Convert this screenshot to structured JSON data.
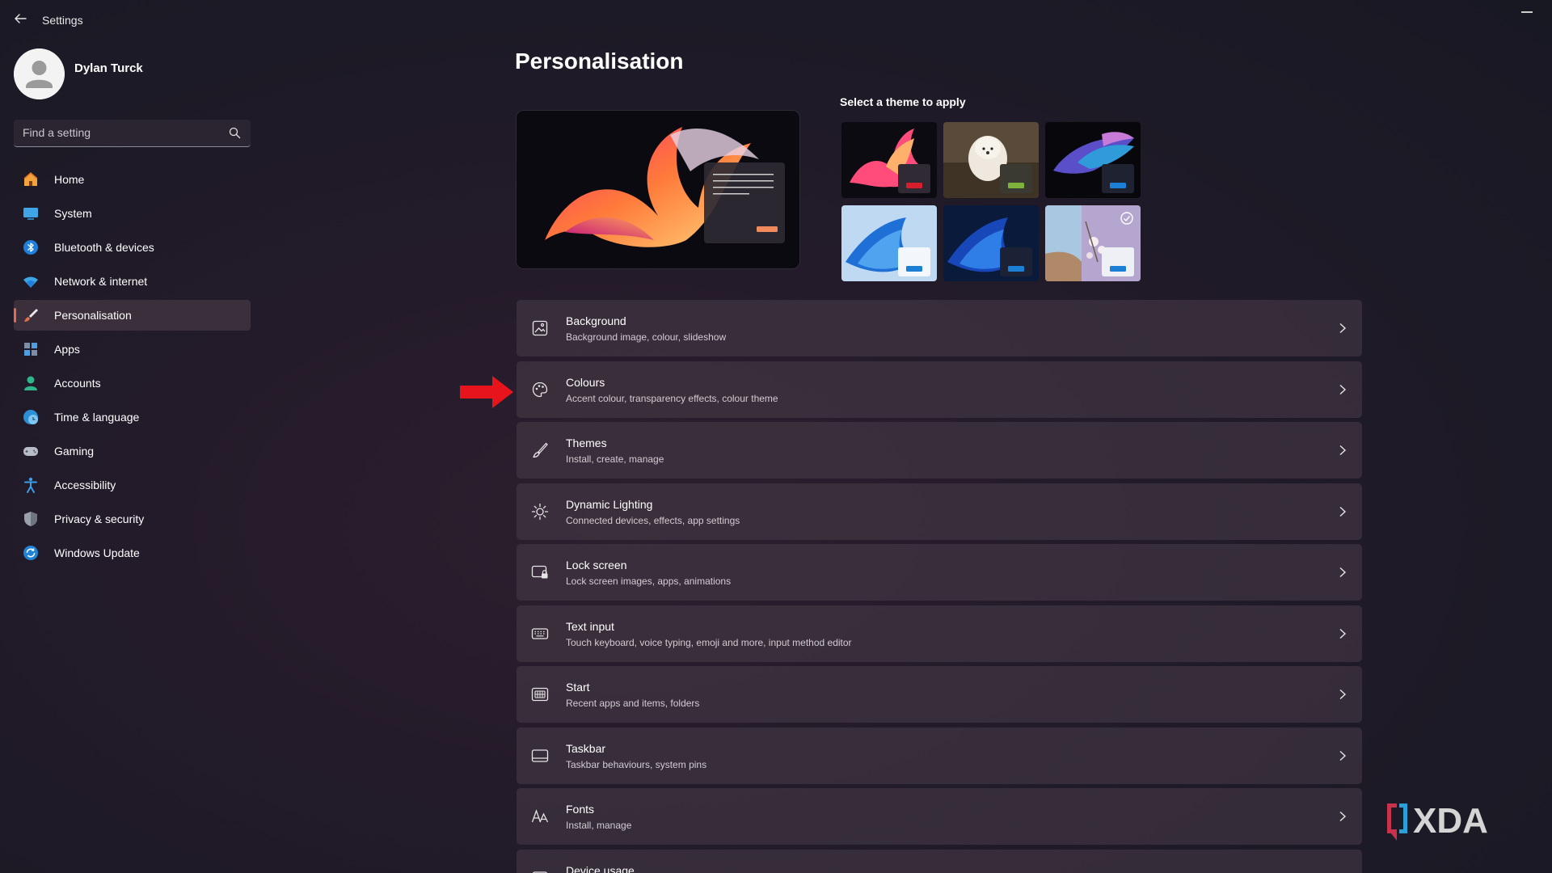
{
  "window": {
    "title": "Settings"
  },
  "profile": {
    "name": "Dylan Turck"
  },
  "search": {
    "placeholder": "Find a setting"
  },
  "sidebar": {
    "items": [
      {
        "label": "Home",
        "icon": "home-icon",
        "active": false
      },
      {
        "label": "System",
        "icon": "system-icon",
        "active": false
      },
      {
        "label": "Bluetooth & devices",
        "icon": "bluetooth-icon",
        "active": false
      },
      {
        "label": "Network & internet",
        "icon": "wifi-icon",
        "active": false
      },
      {
        "label": "Personalisation",
        "icon": "brush-icon",
        "active": true
      },
      {
        "label": "Apps",
        "icon": "apps-icon",
        "active": false
      },
      {
        "label": "Accounts",
        "icon": "accounts-icon",
        "active": false
      },
      {
        "label": "Time & language",
        "icon": "globe-clock-icon",
        "active": false
      },
      {
        "label": "Gaming",
        "icon": "gamepad-icon",
        "active": false
      },
      {
        "label": "Accessibility",
        "icon": "accessibility-icon",
        "active": false
      },
      {
        "label": "Privacy & security",
        "icon": "shield-icon",
        "active": false
      },
      {
        "label": "Windows Update",
        "icon": "update-icon",
        "active": false
      }
    ]
  },
  "main": {
    "title": "Personalisation",
    "theme_heading": "Select a theme to apply",
    "themes": [
      {
        "name": "glow-theme",
        "accent": "#d61f2a"
      },
      {
        "name": "dog-theme",
        "accent": "#7fb23b"
      },
      {
        "name": "dark-bloom-theme",
        "accent": "#1c7fd6"
      },
      {
        "name": "windows-light-theme",
        "accent": "#1c7fd6"
      },
      {
        "name": "windows-dark-theme",
        "accent": "#1c7fd6"
      },
      {
        "name": "flowers-theme",
        "accent": "#1c7fd6"
      }
    ],
    "settings": [
      {
        "title": "Background",
        "desc": "Background image, colour, slideshow",
        "icon": "image-icon"
      },
      {
        "title": "Colours",
        "desc": "Accent colour, transparency effects, colour theme",
        "icon": "palette-icon"
      },
      {
        "title": "Themes",
        "desc": "Install, create, manage",
        "icon": "brush-icon"
      },
      {
        "title": "Dynamic Lighting",
        "desc": "Connected devices, effects, app settings",
        "icon": "sun-icon"
      },
      {
        "title": "Lock screen",
        "desc": "Lock screen images, apps, animations",
        "icon": "lock-screen-icon"
      },
      {
        "title": "Text input",
        "desc": "Touch keyboard, voice typing, emoji and more, input method editor",
        "icon": "keyboard-icon"
      },
      {
        "title": "Start",
        "desc": "Recent apps and items, folders",
        "icon": "start-icon"
      },
      {
        "title": "Taskbar",
        "desc": "Taskbar behaviours, system pins",
        "icon": "taskbar-icon"
      },
      {
        "title": "Fonts",
        "desc": "Install, manage",
        "icon": "fonts-icon"
      },
      {
        "title": "Device usage",
        "desc": "",
        "icon": "device-usage-icon"
      }
    ]
  },
  "watermark": {
    "text": "XDA"
  },
  "colors": {
    "accent": "#e06a52",
    "annotation_arrow": "#e8141b"
  }
}
